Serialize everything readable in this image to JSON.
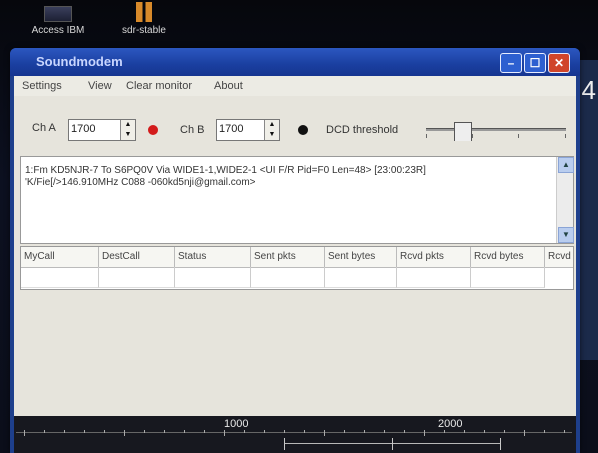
{
  "desktop": {
    "icons": [
      {
        "label": "Access IBM",
        "icon": "monitor-icon"
      },
      {
        "label": "sdr-stable",
        "icon": "folder-icon"
      }
    ],
    "right_edge_text": "4"
  },
  "window": {
    "title": "Soundmodem",
    "controls": {
      "minimize": "–",
      "maximize": "☐",
      "close": "✕"
    }
  },
  "menu": {
    "items": [
      "Settings",
      "View",
      "Clear monitor",
      "About"
    ]
  },
  "toolbar": {
    "cha_label": "Ch A",
    "cha_value": "1700",
    "cha_led_color": "#d31b1b",
    "chb_label": "Ch B",
    "chb_value": "1700",
    "chb_led_color": "#111111",
    "dcd_label": "DCD threshold"
  },
  "monitor": {
    "line1": "1:Fm KD5NJR-7 To S6PQ0V Via WIDE1-1,WIDE2-1 <UI F/R Pid=F0 Len=48> [23:00:23R]",
    "line2": "'K/Fie[/>146.910MHz C088 -060kd5nji@gmail.com>"
  },
  "table": {
    "columns": [
      "MyCall",
      "DestCall",
      "Status",
      "Sent pkts",
      "Sent bytes",
      "Rcvd pkts",
      "Rcvd bytes",
      "Rcvd"
    ]
  },
  "waterfall": {
    "freq_labels": [
      "1000",
      "2000"
    ]
  }
}
